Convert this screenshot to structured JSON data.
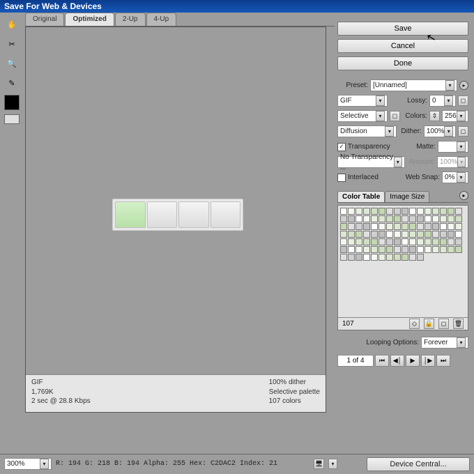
{
  "title": "Save For Web & Devices",
  "tabs": {
    "t0": "Original",
    "t1": "Optimized",
    "t2": "2-Up",
    "t3": "4-Up"
  },
  "buttons": {
    "save": "Save",
    "cancel": "Cancel",
    "done": "Done",
    "device_central": "Device Central..."
  },
  "preset": {
    "label": "Preset:",
    "value": "[Unnamed]"
  },
  "format": {
    "value": "GIF"
  },
  "lossy": {
    "label": "Lossy:",
    "value": "0"
  },
  "reduction": {
    "value": "Selective"
  },
  "colors": {
    "label": "Colors:",
    "value": "256"
  },
  "diffusion": {
    "value": "Diffusion"
  },
  "dither": {
    "label": "Dither:",
    "value": "100%"
  },
  "transparency": {
    "label": "Transparency",
    "checked": true
  },
  "matte": {
    "label": "Matte:",
    "value": ""
  },
  "trans_dither": {
    "value": "No Transparency ..."
  },
  "amount": {
    "label": "Amount:",
    "value": "100%"
  },
  "interlaced": {
    "label": "Interlaced",
    "checked": false
  },
  "websnap": {
    "label": "Web Snap:",
    "value": "0%"
  },
  "coltable": {
    "tab1": "Color Table",
    "tab2": "Image Size",
    "count": "107"
  },
  "looping": {
    "label": "Looping Options:",
    "value": "Forever"
  },
  "frames": {
    "counter": "1 of 4"
  },
  "status": {
    "left1": "GIF",
    "left2": "1,769K",
    "left3": "2 sec @ 28.8 Kbps",
    "right1": "100% dither",
    "right2": "Selective palette",
    "right3": "107 colors"
  },
  "zoom": "300%",
  "pixelinfo": "R: 194  G: 218  B: 194  Alpha: 255  Hex: C2DAC2  Index:   21"
}
